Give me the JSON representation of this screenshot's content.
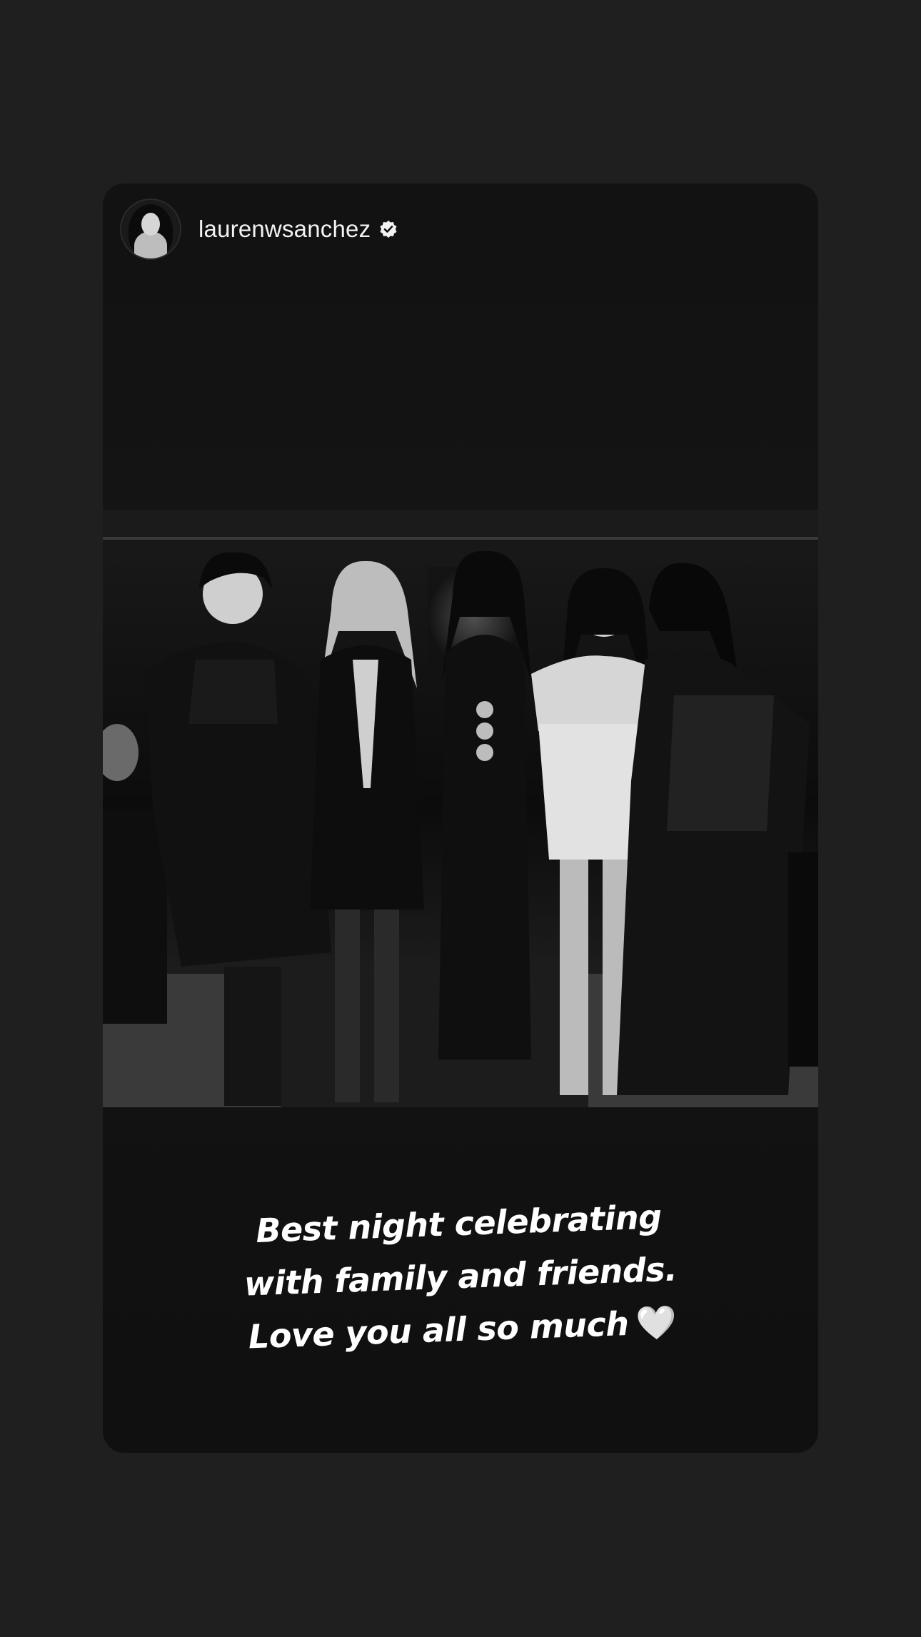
{
  "story": {
    "username": "laurenwsanchez",
    "verified": true,
    "avatar_icon": "profile-avatar",
    "verified_icon": "verified-badge-icon",
    "photo_icon": "group-photo-black-and-white",
    "caption": {
      "line1": "Best night celebrating",
      "line2": "with family and friends.",
      "line3": "Love you all so much",
      "emoji": "🤍"
    }
  },
  "colors": {
    "background": "#1f1f1f",
    "card": "#121212",
    "text": "#ffffff"
  }
}
